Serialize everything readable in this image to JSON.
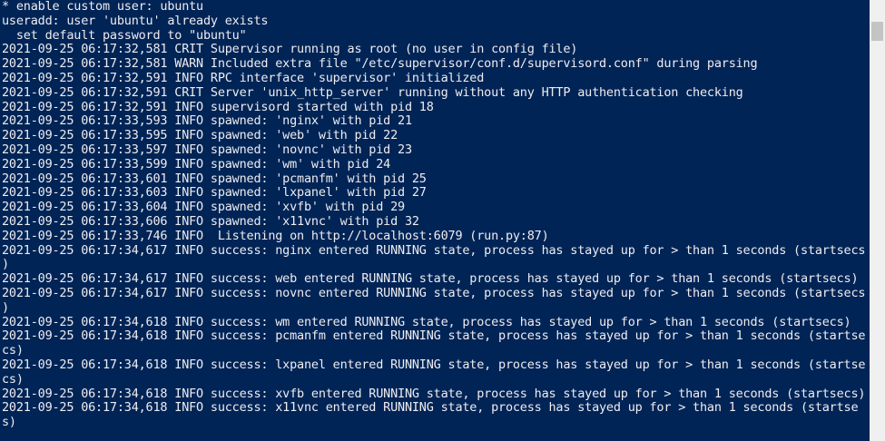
{
  "console": {
    "lines": [
      "* enable custom user: ubuntu",
      "useradd: user 'ubuntu' already exists",
      "  set default password to \"ubuntu\"",
      "2021-09-25 06:17:32,581 CRIT Supervisor running as root (no user in config file)",
      "2021-09-25 06:17:32,581 WARN Included extra file \"/etc/supervisor/conf.d/supervisord.conf\" during parsing",
      "2021-09-25 06:17:32,591 INFO RPC interface 'supervisor' initialized",
      "2021-09-25 06:17:32,591 CRIT Server 'unix_http_server' running without any HTTP authentication checking",
      "2021-09-25 06:17:32,591 INFO supervisord started with pid 18",
      "2021-09-25 06:17:33,593 INFO spawned: 'nginx' with pid 21",
      "2021-09-25 06:17:33,595 INFO spawned: 'web' with pid 22",
      "2021-09-25 06:17:33,597 INFO spawned: 'novnc' with pid 23",
      "2021-09-25 06:17:33,599 INFO spawned: 'wm' with pid 24",
      "2021-09-25 06:17:33,601 INFO spawned: 'pcmanfm' with pid 25",
      "2021-09-25 06:17:33,603 INFO spawned: 'lxpanel' with pid 27",
      "2021-09-25 06:17:33,604 INFO spawned: 'xvfb' with pid 29",
      "2021-09-25 06:17:33,606 INFO spawned: 'x11vnc' with pid 32",
      "2021-09-25 06:17:33,746 INFO  Listening on http://localhost:6079 (run.py:87)",
      "2021-09-25 06:17:34,617 INFO success: nginx entered RUNNING state, process has stayed up for > than 1 seconds (startsecs",
      ")",
      "2021-09-25 06:17:34,617 INFO success: web entered RUNNING state, process has stayed up for > than 1 seconds (startsecs)",
      "2021-09-25 06:17:34,617 INFO success: novnc entered RUNNING state, process has stayed up for > than 1 seconds (startsecs",
      ")",
      "2021-09-25 06:17:34,618 INFO success: wm entered RUNNING state, process has stayed up for > than 1 seconds (startsecs)",
      "2021-09-25 06:17:34,618 INFO success: pcmanfm entered RUNNING state, process has stayed up for > than 1 seconds (startse",
      "cs)",
      "2021-09-25 06:17:34,618 INFO success: lxpanel entered RUNNING state, process has stayed up for > than 1 seconds (startse",
      "cs)",
      "2021-09-25 06:17:34,618 INFO success: xvfb entered RUNNING state, process has stayed up for > than 1 seconds (startsecs)",
      "2021-09-25 06:17:34,618 INFO success: x11vnc entered RUNNING state, process has stayed up for > than 1 seconds (startse",
      "s)"
    ]
  },
  "colors": {
    "background": "#012456",
    "text": "#eeedf0",
    "scrollbar_track": "#f0f0f0",
    "scrollbar_thumb": "#c4c4c4"
  }
}
